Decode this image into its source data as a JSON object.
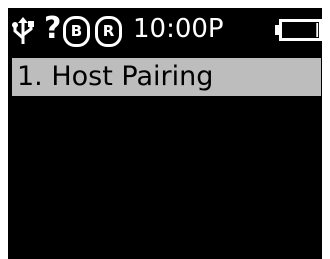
{
  "status_bar": {
    "usb_icon": "usb-icon",
    "unknown_indicator": "?",
    "badge_b": "B",
    "badge_r": "R",
    "time": "10:00P",
    "battery_icon": "battery-icon",
    "battery_level": 0.05
  },
  "menu": {
    "items": [
      {
        "label": "1. Host Pairing",
        "selected": true
      }
    ]
  },
  "colors": {
    "screen_bg": "#000000",
    "text": "#ffffff",
    "selection_bg": "#bdbdbd"
  }
}
